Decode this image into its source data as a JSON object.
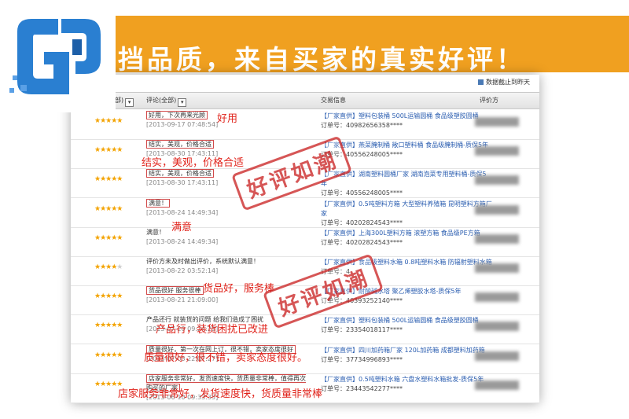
{
  "banner": {
    "text": "挡品质，来自买家的真实好评！"
  },
  "logo": {
    "icon": "gp-logo-icon"
  },
  "screenshot": {
    "date_note": "数据截止到昨天",
    "headers": {
      "col1": "部)",
      "col2": "评论(全部)",
      "col3": "交易信息",
      "col4": "评价方"
    },
    "rows": [
      {
        "stars": 5,
        "comment": "好用，下次再来光顾",
        "date": "[2013-09-17 07:48:54]",
        "trade": "【厂家直供】塑料包装桶 500L运输圆桶 食品级塑胶圆桶",
        "order": "订单号：40982656358****"
      },
      {
        "stars": 5,
        "comment": "结实，美观，价格合适",
        "date": "[2013-08-30 17:43:11]",
        "trade": "【厂家直供】燕菜腌制桶 敞口塑料桶 食品级腌制桶-质保5年",
        "order": "订单号：40556248005****"
      },
      {
        "stars": 5,
        "comment": "结实，美观，价格合适",
        "date": "[2013-08-30 17:43:11]",
        "trade": "【厂家直供】湖南塑料圆桶厂家 湖南泡菜专用塑料桶-质保5年",
        "order": "订单号：40556248005****"
      },
      {
        "stars": 5,
        "comment": "满意！",
        "date": "[2013-08-24 14:49:34]",
        "trade": "【厂家直供】0.5吨塑料方箱 大型塑料养殖箱 昆明塑料方箱厂家",
        "order": "订单号：40202824543****"
      },
      {
        "stars": 5,
        "comment": "满意！",
        "date": "[2013-08-24 14:49:34]",
        "trade": "【厂家直供】上海300L塑料方箱 滚塑方箱 食品级PE方箱",
        "order": "订单号：40202824543****"
      },
      {
        "stars": 4,
        "comment": "评价方未及时做出评价，系统默认满意！",
        "date": "[2013-08-22 03:52:14]",
        "trade": "【厂家直供】食品级塑料水箱 0.8吨塑料水箱 防辐射塑料水箱",
        "order": "订单号：4"
      },
      {
        "stars": 5,
        "comment": "货品很好 服务很棒",
        "date": "[2013-08-21 21:09:00]",
        "trade": "【厂家直供】耐酸碱水塔 聚乙烯塑胶水塔-质保5年",
        "order": "订单号：40393252140****"
      },
      {
        "stars": 5,
        "comment": "产品还行 就装货的问题 给我们造成了困扰",
        "date": "[2013-07-20 09:24:29]",
        "trade": "【厂家直供】塑料包装桶 500L运输圆桶 食品级塑胶圆桶",
        "order": "订单号：23354018117****"
      },
      {
        "stars": 5,
        "comment": "质量很好，第一次在网上订，很不错，卖家态度很好",
        "date": "[2013-07-03 22:07:27]",
        "trade": "【厂家直供】四川加药箱厂家 120L加药箱 成都塑料加药箱",
        "order": "订单号：37734996893****"
      },
      {
        "stars": 5,
        "comment": "店家服务非常好，发货速度快，货质量非常棒，值得再次购买的厂家",
        "date": "[2013-06-10 09:33:35]",
        "trade": "【厂家直供】0.5吨塑料水箱 六盘水塑料水箱批发-质保5年",
        "order": "订单号：23443542277****"
      }
    ]
  },
  "annotations": {
    "a1": "好用",
    "a2": "结实，美观，价格合适",
    "a3": "满意",
    "a4": "货品好，服务棒",
    "a5": "产品行，装货困扰已改进",
    "a6": "质量很好，很不错，卖家态度很好。",
    "a7": "店家服务非常好，发货速度快，货质量非常棒"
  },
  "stamps": {
    "s1": "好评如潮",
    "s2": "好评如潮"
  },
  "colors": {
    "banner": "#f0a020",
    "annotation": "#e0231b",
    "stars": "#f3a300",
    "link": "#2a5db0"
  }
}
